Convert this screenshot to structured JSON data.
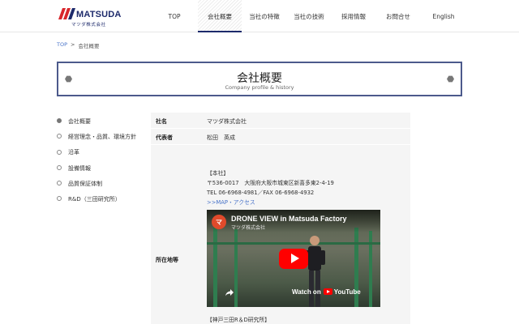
{
  "header": {
    "logo_word": "MATSUDA",
    "logo_sub": "マツダ株式会社",
    "nav": [
      {
        "label": "TOP",
        "active": false
      },
      {
        "label": "会社概要",
        "active": true
      },
      {
        "label": "当社の特徴",
        "active": false
      },
      {
        "label": "当社の技術",
        "active": false
      },
      {
        "label": "採用情報",
        "active": false
      },
      {
        "label": "お問合せ",
        "active": false
      },
      {
        "label": "English",
        "active": false
      }
    ]
  },
  "breadcrumb": {
    "home": "TOP",
    "separator": ">",
    "current": "会社概要"
  },
  "title": {
    "main": "会社概要",
    "sub": "Company profile & history"
  },
  "sidebar": {
    "items": [
      {
        "label": "会社概要",
        "active": true
      },
      {
        "label": "経営理念・品質、環境方針",
        "active": false
      },
      {
        "label": "沿革",
        "active": false
      },
      {
        "label": "設備情報",
        "active": false
      },
      {
        "label": "品質保証体制",
        "active": false
      },
      {
        "label": "R&D（三田研究所）",
        "active": false
      }
    ]
  },
  "profile": {
    "company_label": "社名",
    "company_value": "マツダ株式会社",
    "rep_label": "代表者",
    "rep_value": "松田　英成",
    "address_label": "所在地等",
    "hq_heading": "【本社】",
    "hq_address": "〒536-0017　大阪府大阪市城東区新喜多東2-4-19",
    "hq_tel": "TEL 06-6968-4981／FAX 06-6968-4932",
    "map_link": ">>MAP・アクセス",
    "lab_heading": "【神戸三田R＆D研究所】"
  },
  "video": {
    "avatar_letter": "マ",
    "title": "DRONE VIEW in Matsuda Factory",
    "channel": "マツダ株式会社",
    "watch_on": "Watch on",
    "youtube": "YouTube"
  },
  "colors": {
    "brand_navy": "#1d2a6b",
    "brand_red": "#d8262c",
    "link_blue": "#4a74c9",
    "title_border": "#4c5a8c",
    "table_bg": "#f5f5f5"
  }
}
